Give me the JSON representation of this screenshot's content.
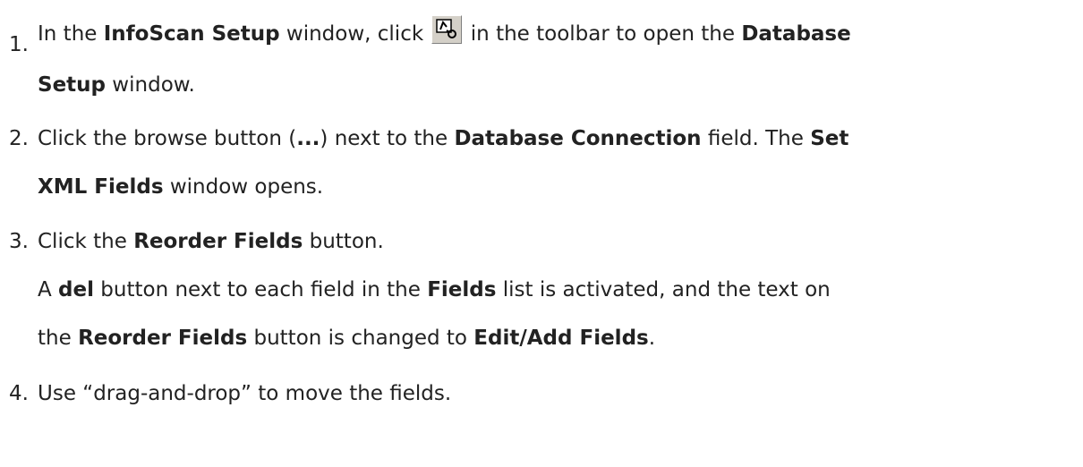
{
  "steps": [
    {
      "number": "1.",
      "parts": [
        "In the ",
        "InfoScan Setup",
        " window, click ",
        " in the toolbar to open the ",
        "Database",
        "Setup",
        " window."
      ]
    },
    {
      "number": "2.",
      "parts": [
        "Click the browse button (",
        "...",
        ") next to the ",
        "Database Connection",
        " field. The ",
        "Set",
        "XML Fields",
        " window opens."
      ]
    },
    {
      "number": "3.",
      "parts": [
        "Click the ",
        "Reorder Fields",
        " button."
      ],
      "note_parts": [
        "A ",
        "del",
        " button next to each field in the ",
        "Fields",
        " list is activated, and the text on",
        "the ",
        "Reorder Fields",
        " button is changed to ",
        "Edit/Add Fields",
        "."
      ]
    },
    {
      "number": "4.",
      "parts": [
        "Use “drag-and-drop” to move the fields."
      ]
    }
  ],
  "toolbar_icon": "database-setup-icon"
}
